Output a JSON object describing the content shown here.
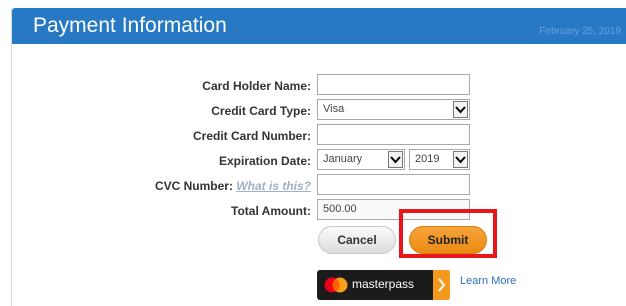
{
  "header": {
    "title": "Payment Information",
    "date": "February 25, 2019"
  },
  "form": {
    "card_holder_label": "Card Holder Name:",
    "card_holder_value": "",
    "card_type_label": "Credit Card Type:",
    "card_type_value": "Visa",
    "card_number_label": "Credit Card Number:",
    "card_number_value": "",
    "expiration_label": "Expiration Date:",
    "expiration_month": "January",
    "expiration_year": "2019",
    "cvc_label": "CVC Number:",
    "cvc_help_link": "What is this?",
    "cvc_value": "",
    "total_label": "Total Amount:",
    "total_value": "500.00"
  },
  "buttons": {
    "cancel": "Cancel",
    "submit": "Submit"
  },
  "masterpass": {
    "brand": "masterpass",
    "learn_more": "Learn More"
  },
  "colors": {
    "header": "#2779c4",
    "submit": "#f39a1e",
    "highlight": "#e8151b",
    "link": "#2e6fbf"
  }
}
